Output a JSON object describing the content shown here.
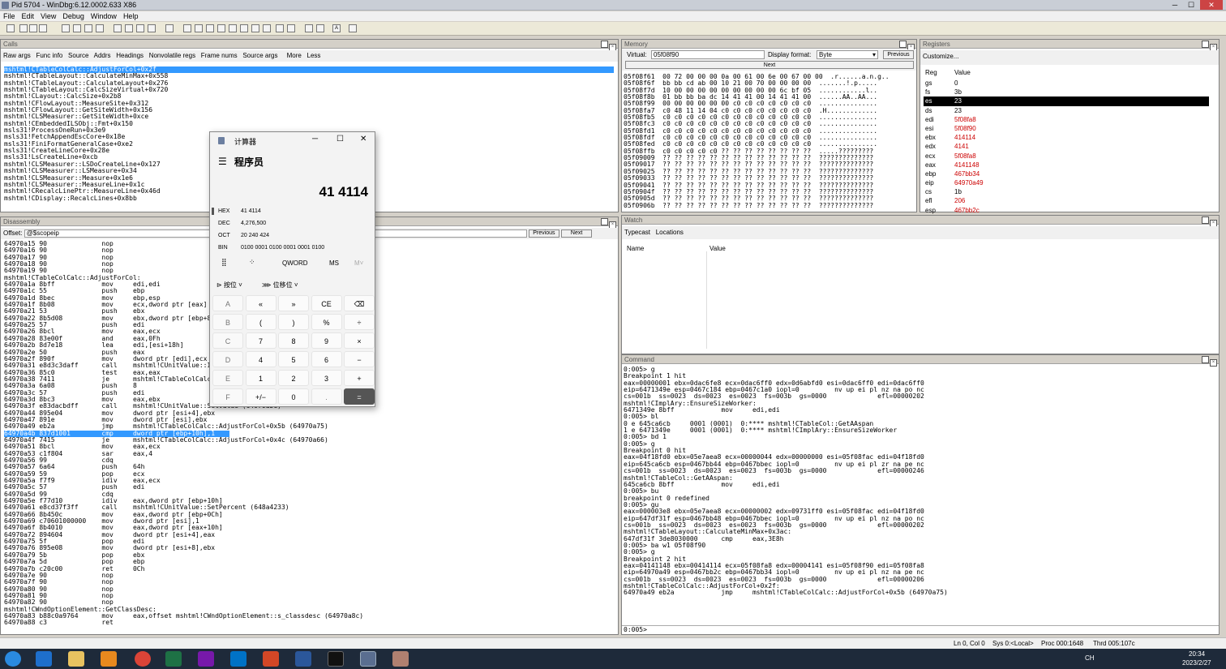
{
  "window": {
    "title": "Pid 5704 - WinDbg:6.12.0002.633 X86"
  },
  "menu": [
    "File",
    "Edit",
    "View",
    "Debug",
    "Window",
    "Help"
  ],
  "calls": {
    "title": "Calls",
    "tabs": [
      "Raw args",
      "Func info",
      "Source",
      "Addrs",
      "Headings",
      "Nonvolatile regs",
      "Frame nums",
      "Source args",
      "More",
      "Less"
    ],
    "lines": [
      "mshtml!CTableColCalc::AdjustForCol+0x2f",
      "mshtml!CTableLayout::CalculateMinMax+0x558",
      "mshtml!CTableLayout::CalculateLayout+0x276",
      "mshtml!CTableLayout::CalcSizeVirtual+0x720",
      "mshtml!CLayout::CalcSize+0x2b8",
      "mshtml!CFlowLayout::MeasureSite+0x312",
      "mshtml!CFlowLayout::GetSiteWidth+0x156",
      "mshtml!CLSMeasurer::GetSiteWidth+0xce",
      "mshtml!CEmbeddedILSObj::Fmt+0x150",
      "msls31!ProcessOneRun+0x3e9",
      "msls31!FetchAppendEscCore+0x18e",
      "msls31!FiniFormatGeneralCase+0xe2",
      "msls31!CreateLineCore+0x28e",
      "msls31!LsCreateLine+0xcb",
      "mshtml!CLSMeasurer::LSDoCreateLine+0x127",
      "mshtml!CLSMeasurer::LSMeasure+0x34",
      "mshtml!CLSMeasurer::Measure+0x1e6",
      "mshtml!CLSMeasurer::MeasureLine+0x1c",
      "mshtml!CRecalcLinePtr::MeasureLine+0x46d",
      "mshtml!CDisplay::RecalcLines+0x8bb"
    ]
  },
  "memory": {
    "title": "Memory",
    "virtual_label": "Virtual:",
    "virtual_value": "05f08f90",
    "display_label": "Display format:",
    "display_value": "Byte",
    "previous": "Previous",
    "next": "Next",
    "lines": [
      "05f08f61  00 72 00 00 00 0a 00 61 00 6e 00 67 00 00  .r......a.n.g..",
      "05f08f6f  bb bb cd ab 00 10 21 00 70 00 00 00 00  .......!.p.....",
      "05f08f7d  10 00 00 00 00 00 00 00 00 00 6c bf 05  ............l..",
      "05f08f8b  01 bb bb ba dc 14 41 41 00 14 41 41 00  ......AA..AA...",
      "05f08f99  00 00 00 00 00 00 c0 c0 c0 c0 c0 c0 c0  ...............",
      "05f08fa7  c0 48 11 14 04 c0 c0 c0 c0 c0 c0 c0 c0  .H.............",
      "05f08fb5  c0 c0 c0 c0 c0 c0 c0 c0 c0 c0 c0 c0 c0  ...............",
      "05f08fc3  c0 c0 c0 c0 c0 c0 c0 c0 c0 c0 c0 c0 c0  ...............",
      "05f08fd1  c0 c0 c0 c0 c0 c0 c0 c0 c0 c0 c0 c0 c0  ...............",
      "05f08fdf  c0 c0 c0 c0 c0 c0 c0 c0 c0 c0 c0 c0 c0  ...............",
      "05f08fed  c0 c0 c0 c0 c0 c0 c0 c0 c0 c0 c0 c0 c0  ...............",
      "05f08ffb  c0 c0 c0 c0 c0 ?? ?? ?? ?? ?? ?? ?? ??  .....?????????",
      "05f09009  ?? ?? ?? ?? ?? ?? ?? ?? ?? ?? ?? ?? ??  ??????????????",
      "05f09017  ?? ?? ?? ?? ?? ?? ?? ?? ?? ?? ?? ?? ??  ??????????????",
      "05f09025  ?? ?? ?? ?? ?? ?? ?? ?? ?? ?? ?? ?? ??  ??????????????",
      "05f09033  ?? ?? ?? ?? ?? ?? ?? ?? ?? ?? ?? ?? ??  ??????????????",
      "05f09041  ?? ?? ?? ?? ?? ?? ?? ?? ?? ?? ?? ?? ??  ??????????????",
      "05f0904f  ?? ?? ?? ?? ?? ?? ?? ?? ?? ?? ?? ?? ??  ??????????????",
      "05f0905d  ?? ?? ?? ?? ?? ?? ?? ?? ?? ?? ?? ?? ??  ??????????????",
      "05f0906b  ?? ?? ?? ?? ?? ?? ?? ?? ?? ?? ?? ?? ??  ??????????????"
    ]
  },
  "registers": {
    "title": "Registers",
    "customize": "Customize...",
    "col_reg": "Reg",
    "col_value": "Value",
    "rows": [
      {
        "r": "gs",
        "v": "0",
        "c": ""
      },
      {
        "r": "fs",
        "v": "3b",
        "c": ""
      },
      {
        "r": "es",
        "v": "23",
        "c": "sel"
      },
      {
        "r": "ds",
        "v": "23",
        "c": ""
      },
      {
        "r": "edi",
        "v": "5f08fa8",
        "c": "red"
      },
      {
        "r": "esi",
        "v": "5f08f90",
        "c": "red"
      },
      {
        "r": "ebx",
        "v": "414114",
        "c": "red"
      },
      {
        "r": "edx",
        "v": "4141",
        "c": "red"
      },
      {
        "r": "ecx",
        "v": "5f08fa8",
        "c": "red"
      },
      {
        "r": "eax",
        "v": "4141148",
        "c": "red"
      },
      {
        "r": "ebp",
        "v": "467bb34",
        "c": "red"
      },
      {
        "r": "eip",
        "v": "64970a49",
        "c": "red"
      },
      {
        "r": "cs",
        "v": "1b",
        "c": ""
      },
      {
        "r": "efl",
        "v": "206",
        "c": "red"
      },
      {
        "r": "esp",
        "v": "467bb2c",
        "c": "red"
      }
    ]
  },
  "watch": {
    "title": "Watch",
    "tabs": [
      "Typecast",
      "Locations"
    ],
    "col_name": "Name",
    "col_value": "Value"
  },
  "disasm": {
    "title": "Disassembly",
    "offset_label": "Offset:",
    "offset_value": "@$scopeip",
    "previous": "Previous",
    "next": "Next",
    "lines": [
      "64970a15 90              nop",
      "64970a16 90              nop",
      "64970a17 90              nop",
      "64970a18 90              nop",
      "64970a19 90              nop",
      "mshtml!CTableColCalc::AdjustForCol:",
      "64970a1a 8bff            mov     edi,edi",
      "64970a1c 55              push    ebp",
      "64970a1d 8bec            mov     ebp,esp",
      "64970a1f 8b08            mov     ecx,dword ptr [eax]",
      "64970a21 53              push    ebx",
      "64970a22 8b5d08          mov     ebx,dword ptr [ebp+8]",
      "64970a25 57              push    edi",
      "64970a26 8bcl            mov     eax,ecx",
      "64970a28 83e00f          and     eax,0Fh",
      "64970a2b 8d7e18          lea     edi,[esi+18h]",
      "64970a2e 50              push    eax",
      "64970a2f 890f            mov     dword ptr [edi],ecx",
      "64970a31 e8d3c3daff      call    mshtml!CUnitValue::IsScalerUnit",
      "64970a36 85c0            test    eax,eax",
      "64970a38 7411            je      mshtml!CTableColCalc::AdjustForCol+0x31",
      "64970a3a 6a08            push    8",
      "64970a3c 57              push    edi",
      "64970a3d 8bc3            mov     eax,ebx",
      "64970a3f e83dacbdff      call    mshtml!CUnitValue::SetValue (64970a5e)",
      "64970a44 895e04          mov     dword ptr [esi+4],ebx",
      "64970a47 891e            mov     dword ptr [esi],ebx",
      "64970a49 eb2a            jmp     mshtml!CTableColCalc::AdjustForCol+0x5b (64970a75)",
      "64970a4b 837d1001        cmp     dword ptr [ebp+10h],1",
      "64970a4f 7415            je      mshtml!CTableColCalc::AdjustForCol+0x4c (64970a66)",
      "64970a51 8bcl            mov     eax,ecx",
      "64970a53 c1f804          sar     eax,4",
      "64970a56 99              cdq",
      "64970a57 6a64            push    64h",
      "64970a59 59              pop     ecx",
      "64970a5a f7f9            idiv    eax,ecx",
      "64970a5c 57              push    edi",
      "64970a5d 99              cdq",
      "64970a5e f77d10          idiv    eax,dword ptr [ebp+10h]",
      "64970a61 e8cd37f3ff      call    mshtml!CUnitValue::SetPercent (648a4233)",
      "64970a66 8b450c          mov     eax,dword ptr [ebp+0Ch]",
      "64970a69 c70601000000    mov     dword ptr [esi],1",
      "64970a6f 8b4010          mov     eax,dword ptr [eax+10h]",
      "64970a72 894604          mov     dword ptr [esi+4],eax",
      "64970a75 5f              pop     edi",
      "64970a76 895e08          mov     dword ptr [esi+8],ebx",
      "64970a79 5b              pop     ebx",
      "64970a7a 5d              pop     ebp",
      "64970a7b c20c00          ret     0Ch",
      "64970a7e 90              nop",
      "64970a7f 90              nop",
      "64970a80 90              nop",
      "64970a81 90              nop",
      "64970a82 90              nop",
      "mshtml!CWndOptionElement::GetClassDesc:",
      "64970a83 b88c0a9764      mov     eax,offset mshtml!CWndOptionElement::s_classdesc (64970a8c)",
      "64970a88 c3              ret"
    ]
  },
  "command": {
    "title": "Command",
    "prompt": "0:005>",
    "lines": [
      "0:005> g",
      "Breakpoint 1 hit",
      "eax=00000001 ebx=0dac6fe8 ecx=0dac6ff0 edx=0d6abfd0 esi=0dac6ff0 edi=0dac6ff0",
      "eip=6471349e esp=0467c184 ebp=0467c1a0 iopl=0         nv up ei pl nz na po nc",
      "cs=001b  ss=0023  ds=0023  es=0023  fs=003b  gs=0000             efl=00000202",
      "mshtml!CImplAry::EnsureSizeWorker:",
      "6471349e 8bff            mov     edi,edi",
      "0:005> bl",
      "0 e 645ca6cb     0001 (0001)  0:**** mshtml!CTableCol::GetAAspan",
      "1 e 6471349e     0001 (0001)  0:**** mshtml!CImplAry::EnsureSizeWorker",
      "0:005> bd 1",
      "0:005> g",
      "Breakpoint 0 hit",
      "eax=04f18fd0 ebx=05e7aea8 ecx=00000044 edx=00000000 esi=05f08fac edi=04f18fd0",
      "eip=645ca6cb esp=0467bb44 ebp=0467bbec iopl=0         nv up ei pl zr na pe nc",
      "cs=001b  ss=0023  ds=0023  es=0023  fs=003b  gs=0000             efl=00000246",
      "mshtml!CTableCol::GetAAspan:",
      "645ca6cb 8bff            mov     edi,edi",
      "0:005> bu",
      "breakpoint 0 redefined",
      "0:005> gu",
      "eax=000003e8 ebx=05e7aea8 ecx=00000002 edx=09731ff0 esi=05f08fac edi=04f18fd0",
      "eip=647df31f esp=0467bb48 ebp=0467bbec iopl=0         nv up ei pl nz na po nc",
      "cs=001b  ss=0023  ds=0023  es=0023  fs=003b  gs=0000             efl=00000202",
      "mshtml!CTableLayout::CalculateMinMax+0x3ac:",
      "647df31f 3de8030000      cmp     eax,3E8h",
      "0:005> ba w1 05f08f90",
      "0:005> g",
      "Breakpoint 2 hit",
      "eax=04141148 ebx=00414114 ecx=05f08fa8 edx=00004141 esi=05f08f90 edi=05f08fa8",
      "eip=64970a49 esp=0467bb2c ebp=0467bb34 iopl=0         nv up ei pl nz na pe nc",
      "cs=001b  ss=0023  ds=0023  es=0023  fs=003b  gs=0000             efl=00000206",
      "mshtml!CTableColCalc::AdjustForCol+0x2f:",
      "64970a49 eb2a            jmp     mshtml!CTableColCalc::AdjustForCol+0x5b (64970a75)"
    ]
  },
  "status": {
    "ln": "Ln 0, Col 0",
    "sys": "Sys 0:<Local>",
    "proc": "Proc 000:1648",
    "thrd": "Thrd 005:107c"
  },
  "calc": {
    "title": "计算器",
    "mode": "程序员",
    "display": "41 4114",
    "bases": [
      {
        "k": "HEX",
        "v": "41 4114"
      },
      {
        "k": "DEC",
        "v": "4,276,500"
      },
      {
        "k": "OCT",
        "v": "20 240 424"
      },
      {
        "k": "BIN",
        "v": "0100 0001 0100 0001 0001 0100"
      }
    ],
    "toggle_word": "QWORD",
    "ms": "MS",
    "mr": "M˅",
    "bitwise": "按位",
    "bitshift": "位移位",
    "buttons": [
      [
        "A",
        "«",
        "»",
        "CE",
        "⌫"
      ],
      [
        "B",
        "(",
        ")",
        "%",
        "÷"
      ],
      [
        "C",
        "7",
        "8",
        "9",
        "×"
      ],
      [
        "D",
        "4",
        "5",
        "6",
        "−"
      ],
      [
        "E",
        "1",
        "2",
        "3",
        "+"
      ],
      [
        "F",
        "+/−",
        "0",
        ".",
        "="
      ]
    ]
  },
  "taskbar": {
    "time": "20:34",
    "date": "2023/2/27",
    "lang": "CH"
  }
}
